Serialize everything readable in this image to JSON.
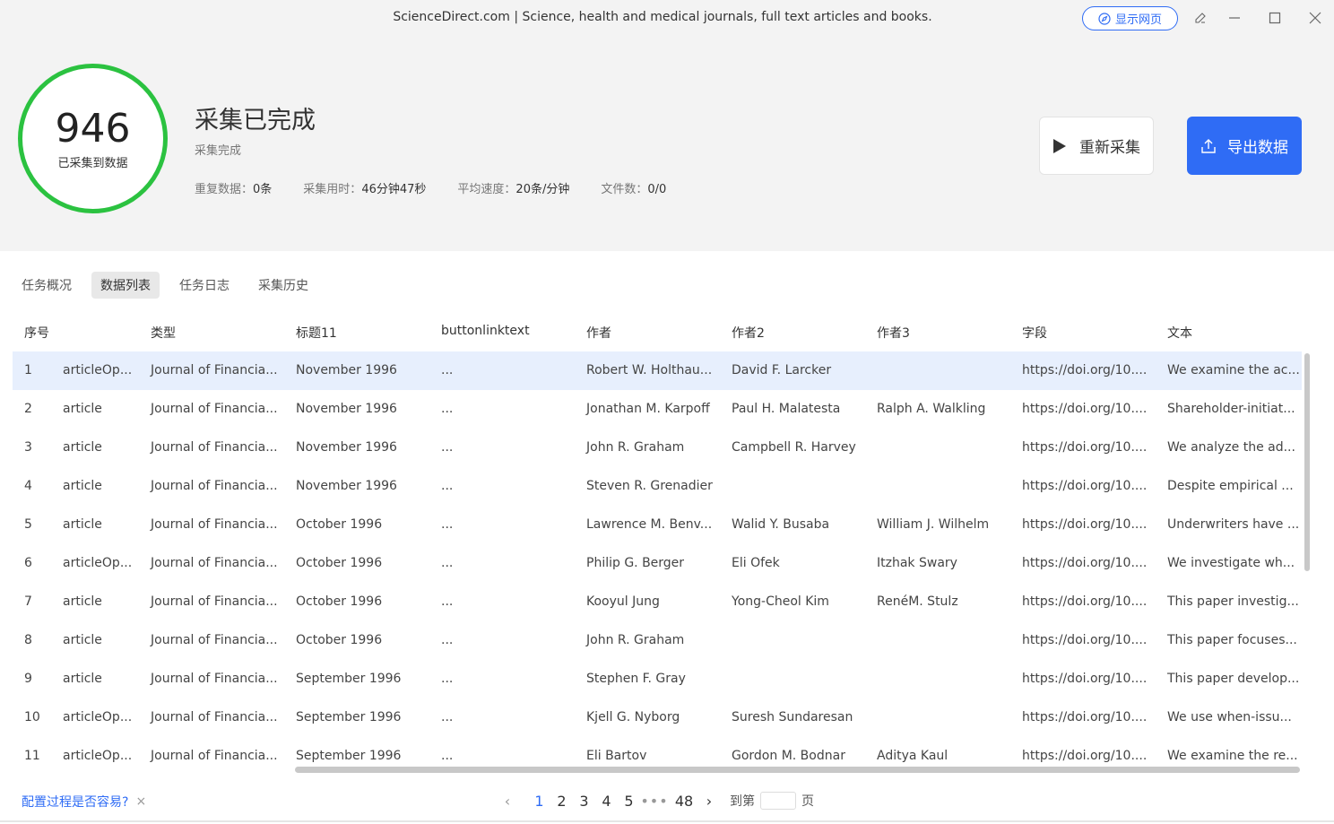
{
  "window": {
    "title": "ScienceDirect.com | Science, health and medical journals, full text articles and books.",
    "show_web_label": "显示网页"
  },
  "summary": {
    "count": "946",
    "count_caption": "已采集到数据",
    "status_title": "采集已完成",
    "status_sub": "采集完成",
    "stats": [
      {
        "label": "重复数据：",
        "value": "0条"
      },
      {
        "label": "采集用时：",
        "value": "46分钟47秒"
      },
      {
        "label": "平均速度：",
        "value": "20条/分钟"
      },
      {
        "label": "文件数：",
        "value": "0/0"
      }
    ],
    "restart_label": "重新采集",
    "export_label": "导出数据",
    "ring_color": "#2bc240",
    "accent_color": "#2f6cf5"
  },
  "tabs": [
    "任务概况",
    "数据列表",
    "任务日志",
    "采集历史"
  ],
  "active_tab": "数据列表",
  "table": {
    "headers": [
      "序号",
      "类型",
      "标题11",
      "buttonlinktext",
      "作者",
      "作者2",
      "作者3",
      "字段",
      "文本"
    ],
    "rows": [
      [
        "1",
        "articleOp...",
        "Journal of Financia...",
        "November 1996",
        "...",
        "Robert W. Holthau...",
        "David F. Larcker",
        "",
        "https://doi.org/10....",
        "We examine the ac..."
      ],
      [
        "2",
        "article",
        "Journal of Financia...",
        "November 1996",
        "...",
        "Jonathan M. Karpoff",
        "Paul H. Malatesta",
        "Ralph A. Walkling",
        "https://doi.org/10....",
        "Shareholder-initiat..."
      ],
      [
        "3",
        "article",
        "Journal of Financia...",
        "November 1996",
        "...",
        "John R. Graham",
        "Campbell R. Harvey",
        "",
        "https://doi.org/10....",
        "We analyze the ad..."
      ],
      [
        "4",
        "article",
        "Journal of Financia...",
        "November 1996",
        "...",
        "Steven R. Grenadier",
        "",
        "",
        "https://doi.org/10....",
        "Despite empirical ..."
      ],
      [
        "5",
        "article",
        "Journal of Financia...",
        "October 1996",
        "...",
        "Lawrence M. Benv...",
        "Walid Y. Busaba",
        "William J. Wilhelm",
        "https://doi.org/10....",
        "Underwriters have ..."
      ],
      [
        "6",
        "articleOp...",
        "Journal of Financia...",
        "October 1996",
        "...",
        "Philip G. Berger",
        "Eli Ofek",
        "Itzhak Swary",
        "https://doi.org/10....",
        "We investigate wh..."
      ],
      [
        "7",
        "article",
        "Journal of Financia...",
        "October 1996",
        "...",
        "Kooyul Jung",
        "Yong-Cheol Kim",
        "RenéM. Stulz",
        "https://doi.org/10....",
        "This paper investig..."
      ],
      [
        "8",
        "article",
        "Journal of Financia...",
        "October 1996",
        "...",
        "John R. Graham",
        "",
        "",
        "https://doi.org/10....",
        "This paper focuses..."
      ],
      [
        "9",
        "article",
        "Journal of Financia...",
        "September 1996",
        "...",
        "Stephen F. Gray",
        "",
        "",
        "https://doi.org/10....",
        "This paper develop..."
      ],
      [
        "10",
        "articleOp...",
        "Journal of Financia...",
        "September 1996",
        "...",
        "Kjell G. Nyborg",
        "Suresh Sundaresan",
        "",
        "https://doi.org/10....",
        "We use when-issu..."
      ],
      [
        "11",
        "articleOp...",
        "Journal of Financia...",
        "September 1996",
        "...",
        "Eli Bartov",
        "Gordon M. Bodnar",
        "Aditya Kaul",
        "https://doi.org/10....",
        "We examine the re..."
      ]
    ]
  },
  "footer": {
    "feedback_label": "配置过程是否容易?",
    "feedback_close": "×",
    "pages": [
      "1",
      "2",
      "3",
      "4",
      "5"
    ],
    "current_page": "1",
    "ellipsis": "•••",
    "last_page": "48",
    "prev": "‹",
    "next": "›",
    "goto_prefix": "到第",
    "goto_suffix": "页"
  }
}
